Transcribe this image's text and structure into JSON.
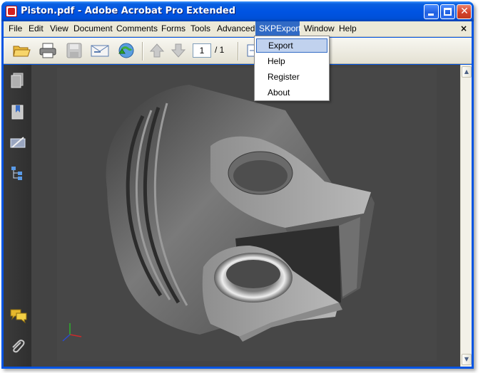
{
  "window": {
    "title": "Piston.pdf - Adobe Acrobat Pro Extended",
    "controls": {
      "minimize": "minimize-icon",
      "maximize": "maximize-icon",
      "close": "close-icon",
      "close_glyph": "✕"
    }
  },
  "menubar": {
    "items": [
      "File",
      "Edit",
      "View",
      "Document",
      "Comments",
      "Forms",
      "Tools",
      "Advanced",
      "SKPExport",
      "Window",
      "Help"
    ],
    "active": "SKPExport",
    "close_glyph": "×"
  },
  "toolbar": {
    "icons": [
      "open-folder-icon",
      "print-icon",
      "save-icon",
      "email-icon",
      "upload-icon",
      "prev-page-icon",
      "next-page-icon"
    ],
    "page_current": "1",
    "page_total": "/ 1"
  },
  "dropdown": {
    "items": [
      "Export",
      "Help",
      "Register",
      "About"
    ],
    "highlighted": "Export"
  },
  "sidebar": {
    "icons": [
      "pages-icon",
      "bookmarks-icon",
      "signatures-icon",
      "model-tree-icon",
      "comments-icon",
      "attachments-icon"
    ]
  },
  "colors": {
    "title_bar": "#0054e3",
    "menu_bg": "#ece9d8",
    "menu_active": "#316ac5",
    "viewer_bg": "#474747",
    "dropdown_hover": "#c1d2ee"
  }
}
